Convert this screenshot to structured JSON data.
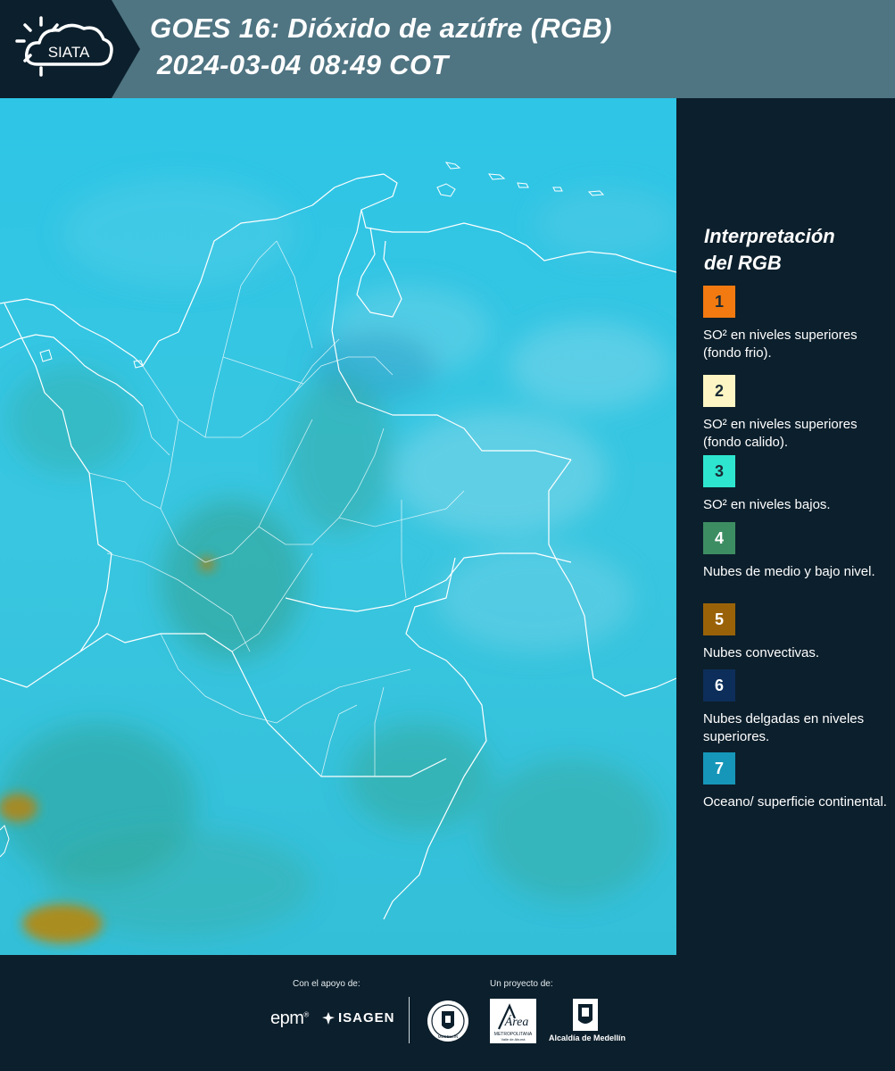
{
  "header": {
    "logo_text": "SIATA",
    "title_line1": "GOES 16: Dióxido de azúfre (RGB)",
    "title_line2": "2024-03-04 08:49 COT"
  },
  "legend": {
    "title_line1": "Interpretación",
    "title_line2": "del RGB",
    "items": [
      {
        "number": "1",
        "color": "#f27a10",
        "label": "SO² en niveles superiores (fondo frio)."
      },
      {
        "number": "2",
        "color": "#fdf6c4",
        "label": "SO² en niveles superiores (fondo calido)."
      },
      {
        "number": "3",
        "color": "#2ee6cf",
        "label": "SO² en niveles bajos."
      },
      {
        "number": "4",
        "color": "#3d8d62",
        "label": "Nubes de medio y bajo nivel."
      },
      {
        "number": "5",
        "color": "#9a6208",
        "label": "Nubes convectivas."
      },
      {
        "number": "6",
        "color": "#0d2e5a",
        "label": "Nubes delgadas en niveles superiores."
      },
      {
        "number": "7",
        "color": "#1696b8",
        "label": "Oceano/ superficie continental."
      }
    ]
  },
  "footer": {
    "support_label": "Con el apoyo de:",
    "project_label": "Un proyecto de:",
    "epm_text": "epm",
    "isagen_text": "ISAGEN",
    "seal_text": "MEDELLÍN",
    "area_text": "Área",
    "area_subtitle": "METROPOLITANA",
    "area_subtitle2": "Valle de Aburrá",
    "alcaldia_text": "Alcaldía de Medellín"
  }
}
